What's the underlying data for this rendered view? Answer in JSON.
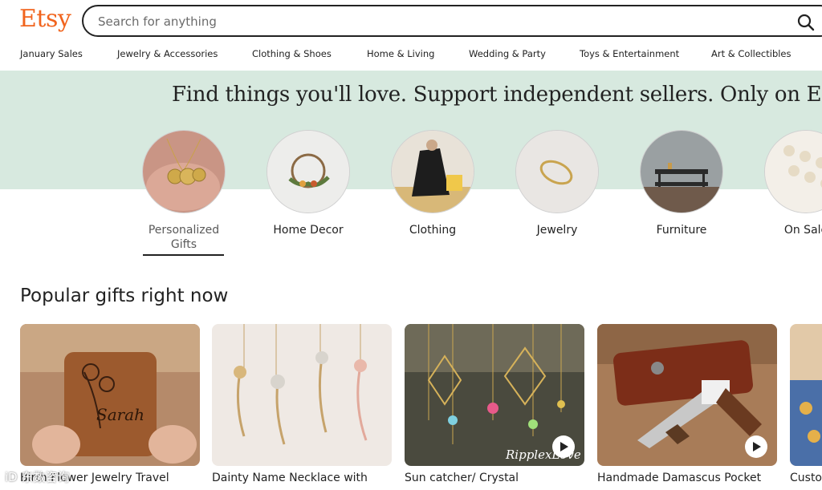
{
  "header": {
    "logo": "Etsy",
    "search_placeholder": "Search for anything"
  },
  "nav": [
    "January Sales",
    "Jewelry & Accessories",
    "Clothing & Shoes",
    "Home & Living",
    "Wedding & Party",
    "Toys & Entertainment",
    "Art & Collectibles"
  ],
  "hero": {
    "title": "Find things you'll love. Support independent sellers. Only on Etsy."
  },
  "categories": [
    {
      "line1": "Personalized",
      "line2": "Gifts"
    },
    {
      "line1": "Home Decor"
    },
    {
      "line1": "Clothing"
    },
    {
      "line1": "Jewelry"
    },
    {
      "line1": "Furniture"
    },
    {
      "line1": "On Sale"
    }
  ],
  "popular": {
    "title": "Popular gifts right now",
    "items": [
      {
        "title": "Birth Flower Jewelry Travel",
        "image_text": "Sarah"
      },
      {
        "title": "Dainty Name Necklace with"
      },
      {
        "title": "Sun catcher/ Crystal",
        "image_text": "RipplexLove"
      },
      {
        "title": "Handmade Damascus Pocket"
      },
      {
        "title": "Custo"
      }
    ]
  },
  "watermark": "iD 东数咨询",
  "colors": {
    "brand": "#f1641e",
    "hero_bg": "#d7e9df"
  }
}
